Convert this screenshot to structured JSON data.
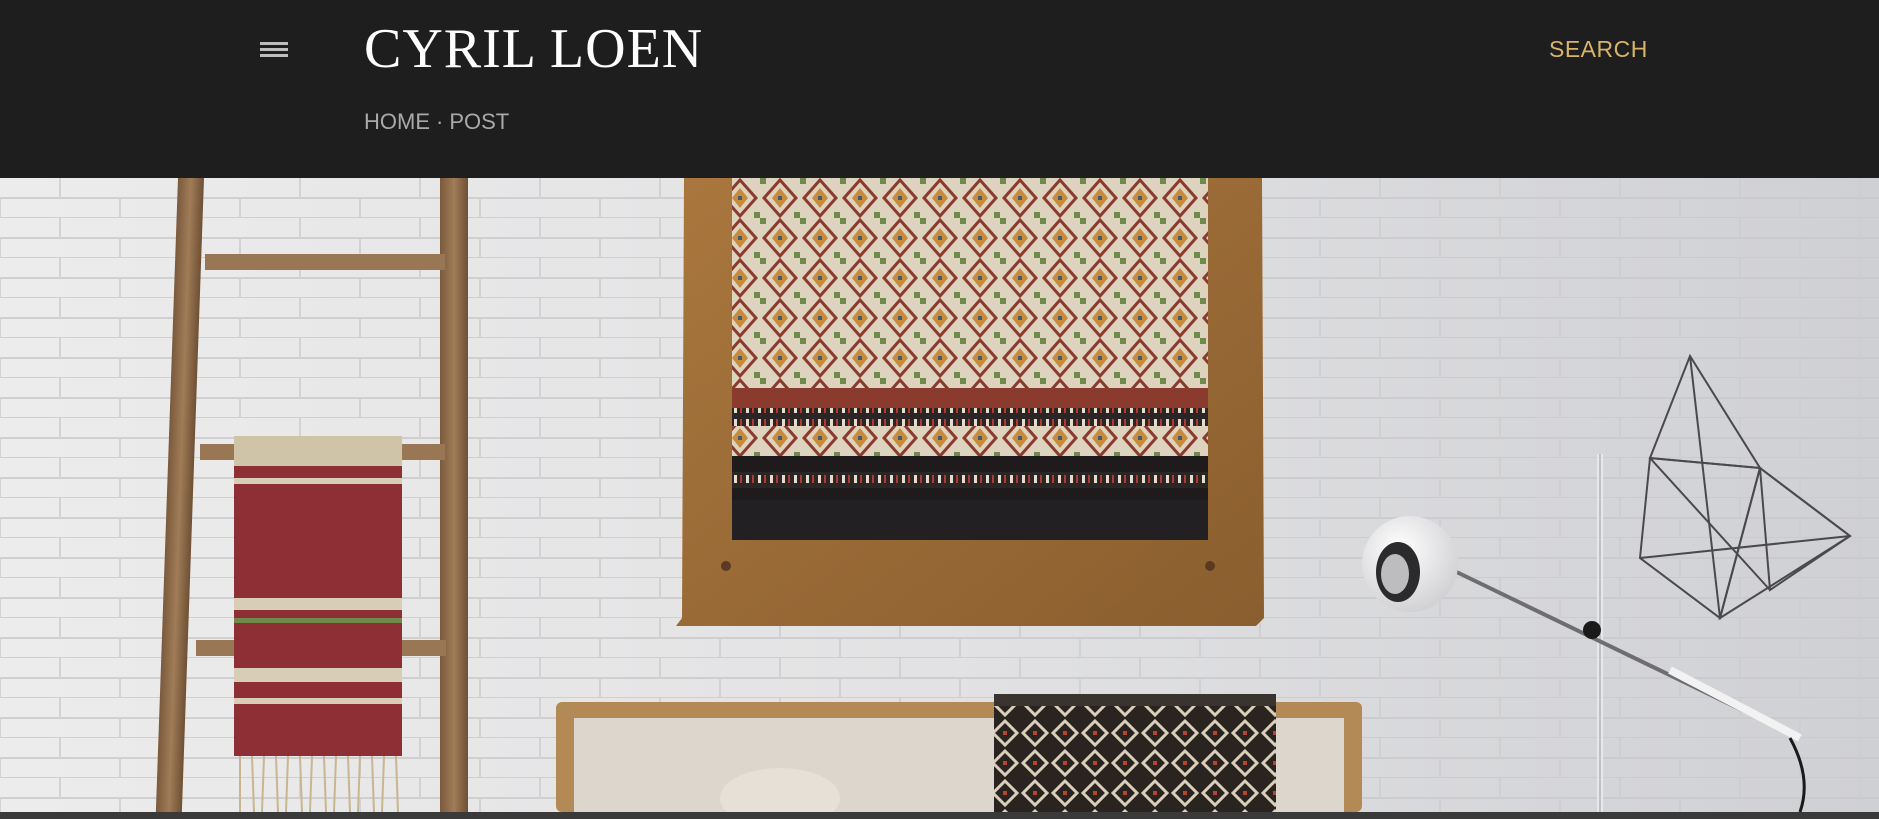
{
  "header": {
    "menu_icon": "hamburger-menu-icon",
    "site_title": "CYRIL LOEN",
    "search_label": "SEARCH",
    "breadcrumb": {
      "home": "HOME",
      "separator": "·",
      "current": "POST"
    }
  },
  "colors": {
    "header_background": "#1e1e1e",
    "title": "#ffffff",
    "search_accent": "#d8b46a",
    "breadcrumb": "#a9a9a9"
  },
  "hero_image": {
    "subject": "interior-photo-brick-wall-tapestry-ladder-lamp"
  }
}
